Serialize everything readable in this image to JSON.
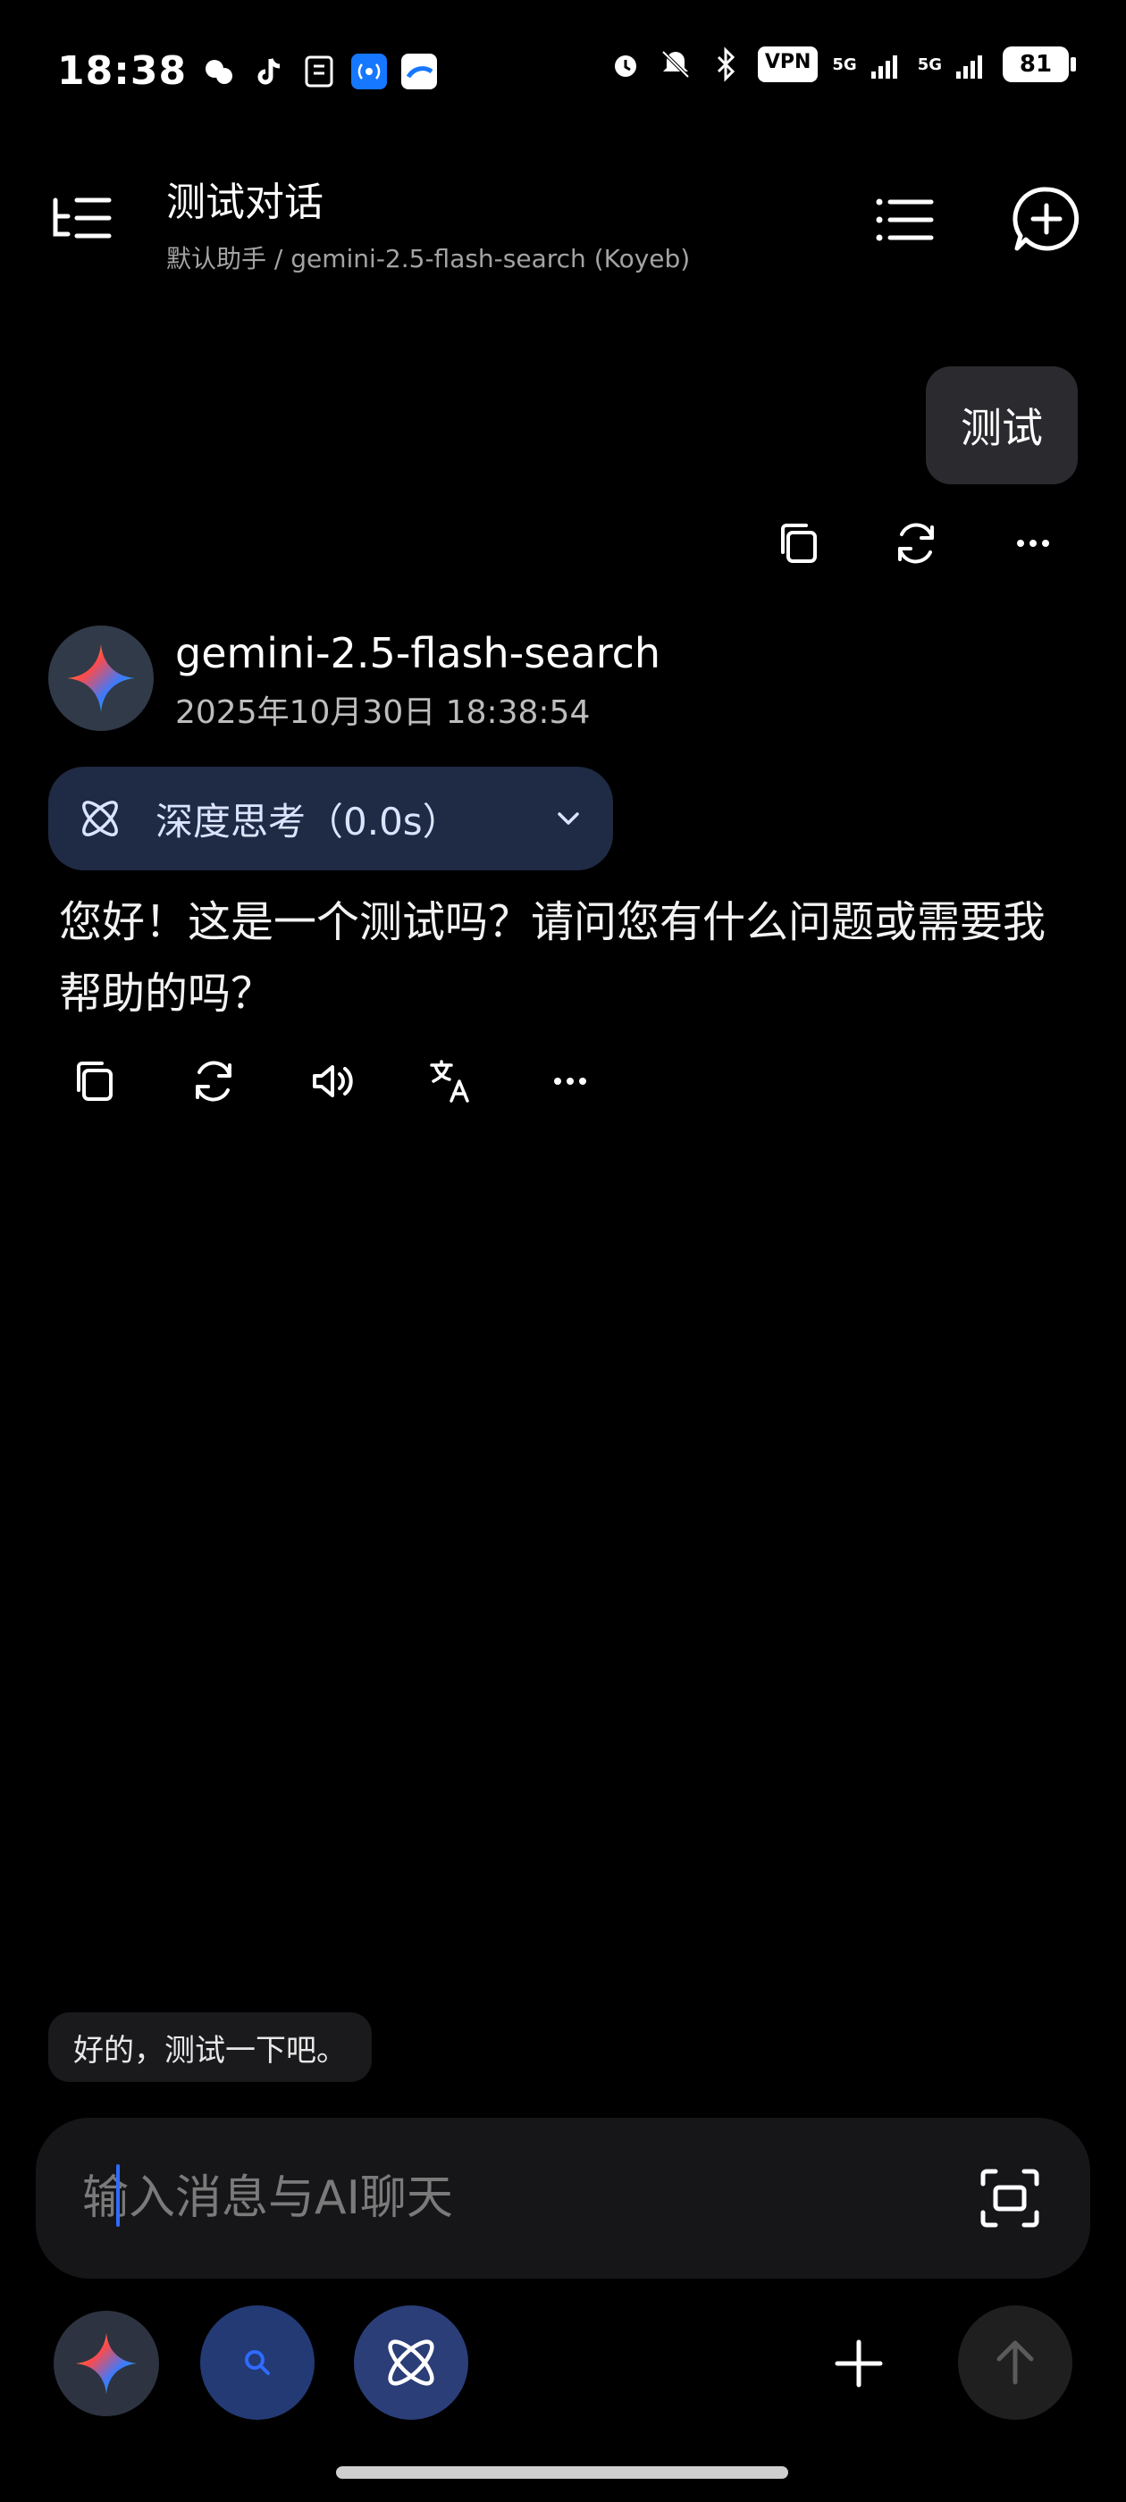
{
  "status_bar": {
    "time": "18:38",
    "vpn": "VPN",
    "network": "5G",
    "battery": "81"
  },
  "header": {
    "title": "测试对话",
    "subtitle": "默认助手 / gemini-2.5-flash-search (Koyeb)"
  },
  "conversation": {
    "user_message": "测试",
    "assistant": {
      "model": "gemini-2.5-flash-search",
      "timestamp": "2025年10月30日 18:38:54",
      "thinking_label": "深度思考（0.0s）",
      "reply": "您好！这是一个测试吗？请问您有什么问题或需要我帮助的吗？"
    }
  },
  "suggestion": "好的，测试一下吧。",
  "input": {
    "placeholder": "输入消息与AI聊天"
  },
  "colors": {
    "background": "#000000",
    "accent": "#2f6bff",
    "bubble": "#2b2b2f",
    "thinking_pill": "#1f2a44"
  }
}
